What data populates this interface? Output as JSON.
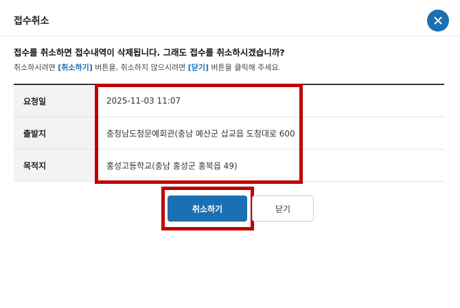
{
  "dialog": {
    "title": "접수취소",
    "close_icon": "close-icon"
  },
  "message": {
    "main": "접수를 취소하면 접수내역이 삭제됩니다. 그래도 접수를 취소하시겠습니까?",
    "sub_part1": "취소하시려면 ",
    "sub_hl1": "[취소하기]",
    "sub_part2": " 버튼을, 취소하지 않으시려면 ",
    "sub_hl2": "[닫기]",
    "sub_part3": " 버튼을 클릭해 주세요."
  },
  "details": [
    {
      "label": "요청일",
      "value": "2025-11-03 11:07"
    },
    {
      "label": "출발지",
      "value": "충청남도청문예회관(충남 예산군 삽교읍 도청대로 600"
    },
    {
      "label": "목적지",
      "value": "홍성고등학교(충남 홍성군 홍북읍 49)"
    }
  ],
  "buttons": {
    "cancel_label": "취소하기",
    "close_label": "닫기"
  },
  "colors": {
    "accent": "#1b6fb3",
    "highlight": "#c00000"
  }
}
